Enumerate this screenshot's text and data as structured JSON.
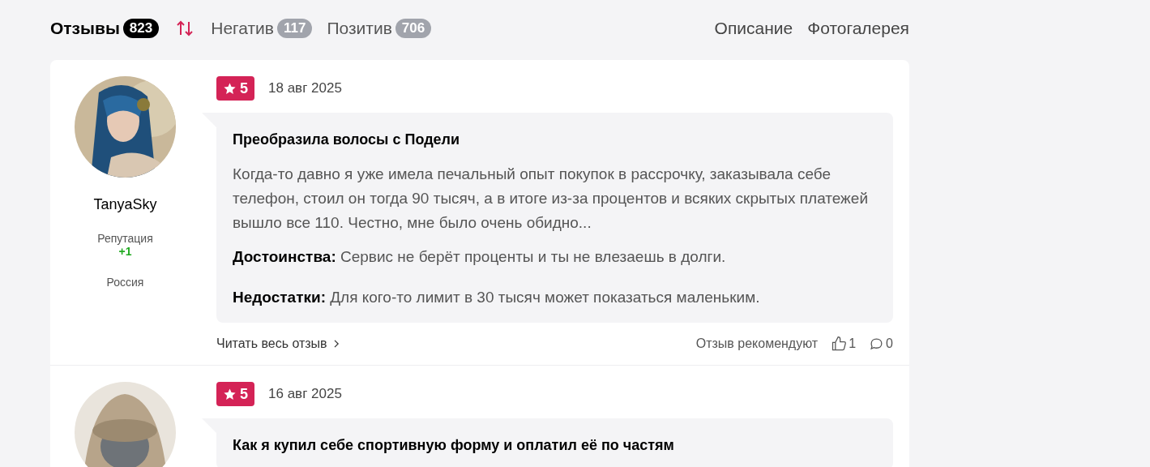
{
  "tabs": [
    {
      "label": "Отзывы",
      "count": "823",
      "selected": true
    },
    {
      "label": "Негатив",
      "count": "117",
      "selected": false
    },
    {
      "label": "Позитив",
      "count": "706",
      "selected": false
    }
  ],
  "links": [
    "Описание",
    "Фотогалерея"
  ],
  "reviews": [
    {
      "author": "TanyaSky",
      "reputation_label": "Репутация",
      "reputation": "+1",
      "country": "Россия",
      "rating": "5",
      "date": "18 авг 2025",
      "title": "Преобразила волосы с Подели",
      "text": "Когда-то давно я уже имела печальный опыт покупок в рассрочку, заказывала себе телефон, стоил он тогда 90 тысяч, а в итоге из-за процентов и всяких скрытых платежей вышло все 110. Честно, мне было очень обидно...",
      "pros": "**Достоинства:** Сервис не берёт проценты и ты не влезаешь в долги.",
      "cons": "**Недостатки:** Для кого-то лимит в 30 тысяч может показаться маленьким.",
      "read_more": "Читать весь отзыв",
      "recommend": "Отзыв рекомендуют",
      "likes": "1",
      "comments": "0"
    },
    {
      "rating": "5",
      "date": "16 авг 2025",
      "title": "Как я купил себе спортивную форму и оплатил её по частям"
    }
  ]
}
